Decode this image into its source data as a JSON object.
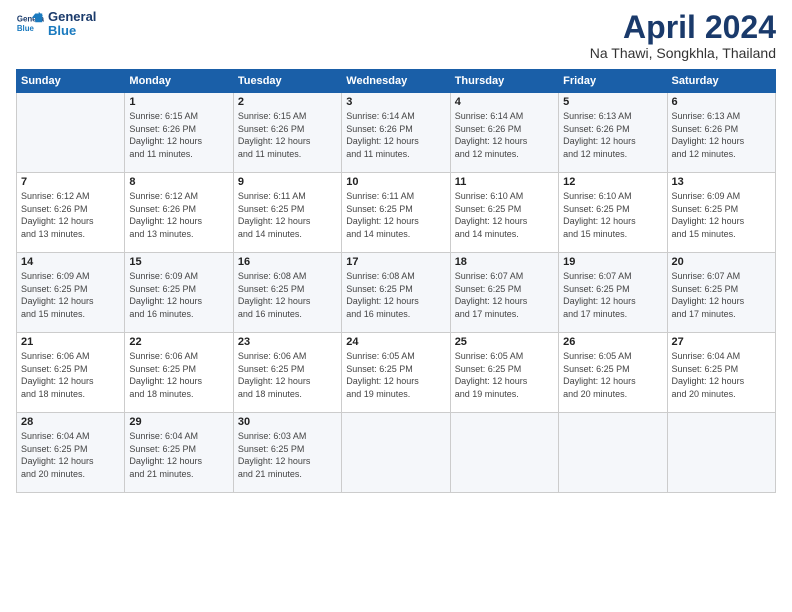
{
  "logo": {
    "line1": "General",
    "line2": "Blue"
  },
  "title": "April 2024",
  "location": "Na Thawi, Songkhla, Thailand",
  "weekdays": [
    "Sunday",
    "Monday",
    "Tuesday",
    "Wednesday",
    "Thursday",
    "Friday",
    "Saturday"
  ],
  "weeks": [
    [
      {
        "day": "",
        "info": ""
      },
      {
        "day": "1",
        "info": "Sunrise: 6:15 AM\nSunset: 6:26 PM\nDaylight: 12 hours\nand 11 minutes."
      },
      {
        "day": "2",
        "info": "Sunrise: 6:15 AM\nSunset: 6:26 PM\nDaylight: 12 hours\nand 11 minutes."
      },
      {
        "day": "3",
        "info": "Sunrise: 6:14 AM\nSunset: 6:26 PM\nDaylight: 12 hours\nand 11 minutes."
      },
      {
        "day": "4",
        "info": "Sunrise: 6:14 AM\nSunset: 6:26 PM\nDaylight: 12 hours\nand 12 minutes."
      },
      {
        "day": "5",
        "info": "Sunrise: 6:13 AM\nSunset: 6:26 PM\nDaylight: 12 hours\nand 12 minutes."
      },
      {
        "day": "6",
        "info": "Sunrise: 6:13 AM\nSunset: 6:26 PM\nDaylight: 12 hours\nand 12 minutes."
      }
    ],
    [
      {
        "day": "7",
        "info": "Sunrise: 6:12 AM\nSunset: 6:26 PM\nDaylight: 12 hours\nand 13 minutes."
      },
      {
        "day": "8",
        "info": "Sunrise: 6:12 AM\nSunset: 6:26 PM\nDaylight: 12 hours\nand 13 minutes."
      },
      {
        "day": "9",
        "info": "Sunrise: 6:11 AM\nSunset: 6:25 PM\nDaylight: 12 hours\nand 14 minutes."
      },
      {
        "day": "10",
        "info": "Sunrise: 6:11 AM\nSunset: 6:25 PM\nDaylight: 12 hours\nand 14 minutes."
      },
      {
        "day": "11",
        "info": "Sunrise: 6:10 AM\nSunset: 6:25 PM\nDaylight: 12 hours\nand 14 minutes."
      },
      {
        "day": "12",
        "info": "Sunrise: 6:10 AM\nSunset: 6:25 PM\nDaylight: 12 hours\nand 15 minutes."
      },
      {
        "day": "13",
        "info": "Sunrise: 6:09 AM\nSunset: 6:25 PM\nDaylight: 12 hours\nand 15 minutes."
      }
    ],
    [
      {
        "day": "14",
        "info": "Sunrise: 6:09 AM\nSunset: 6:25 PM\nDaylight: 12 hours\nand 15 minutes."
      },
      {
        "day": "15",
        "info": "Sunrise: 6:09 AM\nSunset: 6:25 PM\nDaylight: 12 hours\nand 16 minutes."
      },
      {
        "day": "16",
        "info": "Sunrise: 6:08 AM\nSunset: 6:25 PM\nDaylight: 12 hours\nand 16 minutes."
      },
      {
        "day": "17",
        "info": "Sunrise: 6:08 AM\nSunset: 6:25 PM\nDaylight: 12 hours\nand 16 minutes."
      },
      {
        "day": "18",
        "info": "Sunrise: 6:07 AM\nSunset: 6:25 PM\nDaylight: 12 hours\nand 17 minutes."
      },
      {
        "day": "19",
        "info": "Sunrise: 6:07 AM\nSunset: 6:25 PM\nDaylight: 12 hours\nand 17 minutes."
      },
      {
        "day": "20",
        "info": "Sunrise: 6:07 AM\nSunset: 6:25 PM\nDaylight: 12 hours\nand 17 minutes."
      }
    ],
    [
      {
        "day": "21",
        "info": "Sunrise: 6:06 AM\nSunset: 6:25 PM\nDaylight: 12 hours\nand 18 minutes."
      },
      {
        "day": "22",
        "info": "Sunrise: 6:06 AM\nSunset: 6:25 PM\nDaylight: 12 hours\nand 18 minutes."
      },
      {
        "day": "23",
        "info": "Sunrise: 6:06 AM\nSunset: 6:25 PM\nDaylight: 12 hours\nand 18 minutes."
      },
      {
        "day": "24",
        "info": "Sunrise: 6:05 AM\nSunset: 6:25 PM\nDaylight: 12 hours\nand 19 minutes."
      },
      {
        "day": "25",
        "info": "Sunrise: 6:05 AM\nSunset: 6:25 PM\nDaylight: 12 hours\nand 19 minutes."
      },
      {
        "day": "26",
        "info": "Sunrise: 6:05 AM\nSunset: 6:25 PM\nDaylight: 12 hours\nand 20 minutes."
      },
      {
        "day": "27",
        "info": "Sunrise: 6:04 AM\nSunset: 6:25 PM\nDaylight: 12 hours\nand 20 minutes."
      }
    ],
    [
      {
        "day": "28",
        "info": "Sunrise: 6:04 AM\nSunset: 6:25 PM\nDaylight: 12 hours\nand 20 minutes."
      },
      {
        "day": "29",
        "info": "Sunrise: 6:04 AM\nSunset: 6:25 PM\nDaylight: 12 hours\nand 21 minutes."
      },
      {
        "day": "30",
        "info": "Sunrise: 6:03 AM\nSunset: 6:25 PM\nDaylight: 12 hours\nand 21 minutes."
      },
      {
        "day": "",
        "info": ""
      },
      {
        "day": "",
        "info": ""
      },
      {
        "day": "",
        "info": ""
      },
      {
        "day": "",
        "info": ""
      }
    ]
  ]
}
